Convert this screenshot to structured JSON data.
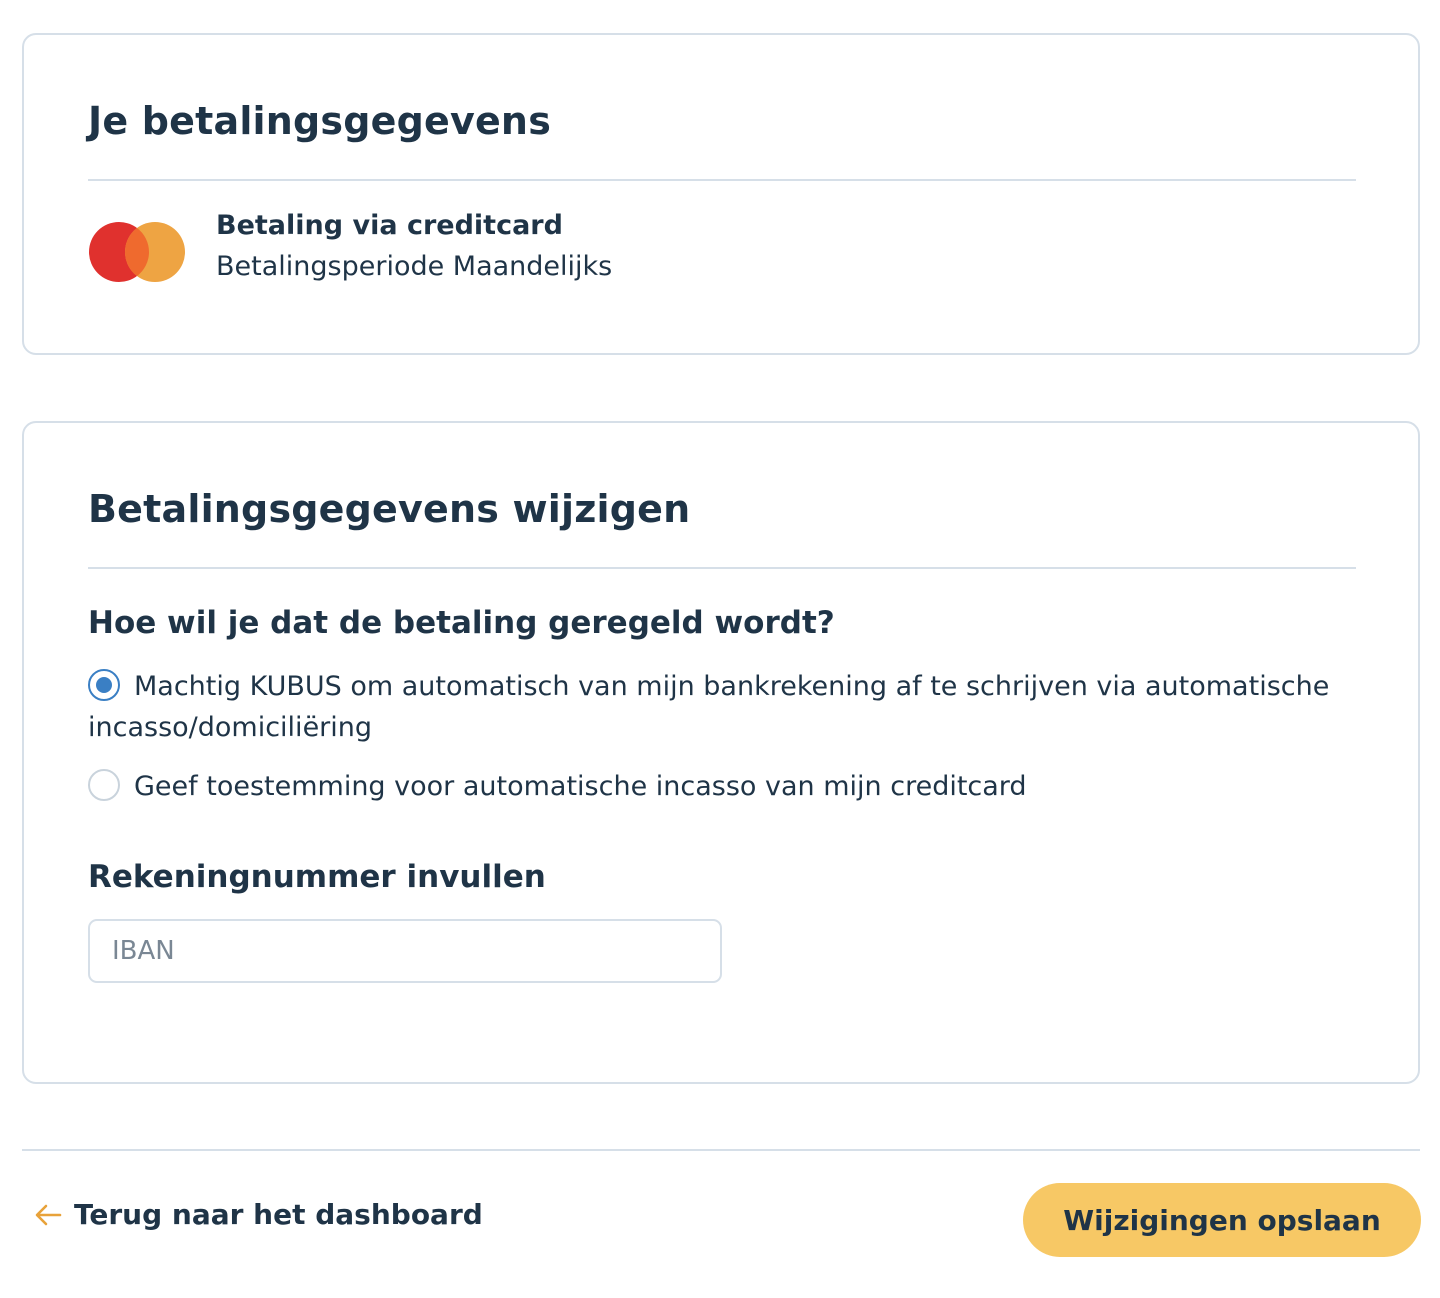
{
  "current_payment": {
    "title": "Je betalingsgegevens",
    "card_brand_icon": "mastercard-icon",
    "method_label": "Betaling via creditcard",
    "period_label": "Betalingsperiode Maandelijks"
  },
  "change_payment": {
    "title": "Betalingsgegevens wijzigen",
    "question": "Hoe wil je dat de betaling geregeld wordt?",
    "options": [
      {
        "label": "Machtig KUBUS om automatisch van mijn bankrekening af te schrijven via automatische incasso/domiciliëring",
        "selected": true
      },
      {
        "label": "Geef toestemming voor automatische incasso van mijn creditcard",
        "selected": false
      }
    ],
    "account_label": "Rekeningnummer invullen",
    "iban_placeholder": "IBAN",
    "iban_value": ""
  },
  "footer": {
    "back_label": "Terug naar het dashboard",
    "save_label": "Wijzigingen opslaan"
  },
  "colors": {
    "text": "#1f3447",
    "border": "#d6dfe8",
    "accent_button": "#f7c865",
    "radio_selected": "#3a7fc4",
    "back_arrow": "#e8a23a",
    "mastercard_red": "#e0312e",
    "mastercard_orange": "#eea443"
  }
}
